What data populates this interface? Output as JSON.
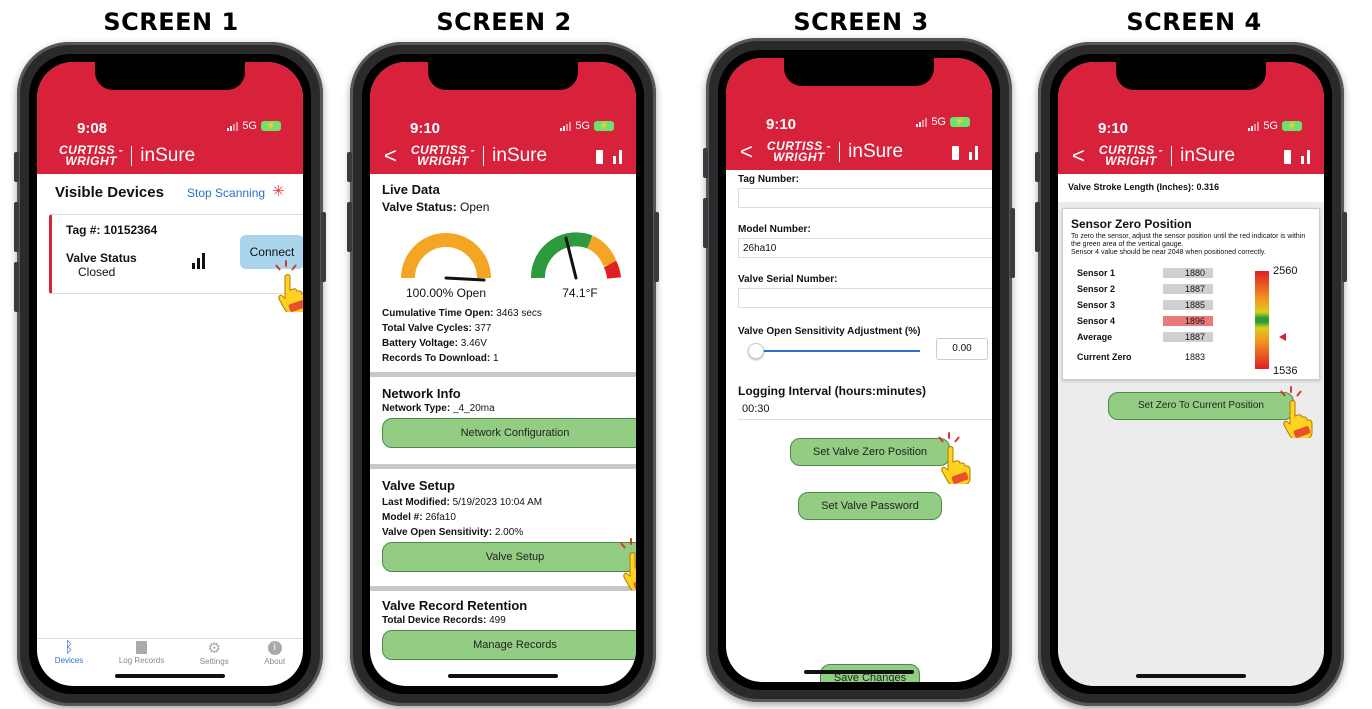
{
  "screen_titles": [
    "SCREEN 1",
    "SCREEN 2",
    "SCREEN 3",
    "SCREEN 4"
  ],
  "common": {
    "logo_line1": "CURTISS -",
    "logo_line2": "WRIGHT",
    "app_name": "inSure",
    "network": "5G",
    "back_glyph": "<",
    "tap_badge": "Click Here"
  },
  "screen1": {
    "time": "9:08",
    "heading": "Visible Devices",
    "stop_scanning": "Stop Scanning",
    "tag_label": "Tag #:",
    "tag_value": "10152364",
    "status_label": "Valve Status",
    "status_value": "Closed",
    "connect": "Connect",
    "nav": [
      {
        "label": "Devices",
        "icon": "bluetooth-icon"
      },
      {
        "label": "Log Records",
        "icon": "document-icon"
      },
      {
        "label": "Settings",
        "icon": "gear-icon"
      },
      {
        "label": "About",
        "icon": "info-icon"
      }
    ]
  },
  "screen2": {
    "time": "9:10",
    "live_title": "Live Data",
    "valve_status_label": "Valve Status:",
    "valve_status_value": "Open",
    "gauge1_value": "100.00% Open",
    "gauge1_fraction": 1.0,
    "gauge2_value": "74.1°F",
    "stats": [
      {
        "label": "Cumulative Time Open:",
        "value": "3463 secs"
      },
      {
        "label": "Total Valve Cycles:",
        "value": "377"
      },
      {
        "label": "Battery Voltage:",
        "value": "3.46V"
      },
      {
        "label": "Records To Download:",
        "value": "1"
      }
    ],
    "network_title": "Network Info",
    "network_type_label": "Network Type:",
    "network_type_value": "_4_20ma",
    "network_btn": "Network Configuration",
    "setup_title": "Valve Setup",
    "last_modified_label": "Last Modified:",
    "last_modified_value": "5/19/2023 10:04 AM",
    "model_label": "Model #:",
    "model_value": "26fa10",
    "sensitivity_label": "Valve Open Sensitivity:",
    "sensitivity_value": "2.00%",
    "setup_btn": "Valve Setup",
    "retention_title": "Valve Record Retention",
    "records_label": "Total Device Records:",
    "records_value": "499",
    "manage_btn": "Manage Records"
  },
  "screen3": {
    "time": "9:10",
    "tag_label": "Tag Number:",
    "tag_value": "",
    "model_label": "Model Number:",
    "model_value": "26ha10",
    "serial_label": "Valve Serial Number:",
    "serial_value": "",
    "sens_label": "Valve Open Sensitivity Adjustment (%)",
    "sens_value": "0.00",
    "log_label": "Logging Interval (hours:minutes)",
    "log_value": "00:30",
    "zero_btn": "Set Valve Zero Position",
    "password_btn": "Set Valve Password",
    "save_btn": "Save Changes"
  },
  "screen4": {
    "time": "9:10",
    "stroke_label": "Valve Stroke Length (Inches):",
    "stroke_value": "0.316",
    "panel_title": "Sensor Zero Position",
    "panel_desc1": "To zero the sensor, adjust the sensor position until the red indicator is within the green area of the vertical gauge.",
    "panel_desc2": "Sensor 4 value should be near 2048 when positioned correctly.",
    "sensors": [
      {
        "label": "Sensor 1",
        "value": "1880",
        "highlight": false
      },
      {
        "label": "Sensor 2",
        "value": "1887",
        "highlight": false
      },
      {
        "label": "Sensor 3",
        "value": "1885",
        "highlight": false
      },
      {
        "label": "Sensor 4",
        "value": "1896",
        "highlight": true
      },
      {
        "label": "Average",
        "value": "1887",
        "highlight": false
      }
    ],
    "current_zero_label": "Current Zero",
    "current_zero_value": "1883",
    "scale_max": "2560",
    "scale_min": "1536",
    "zero_btn": "Set Zero To Current Position"
  }
}
